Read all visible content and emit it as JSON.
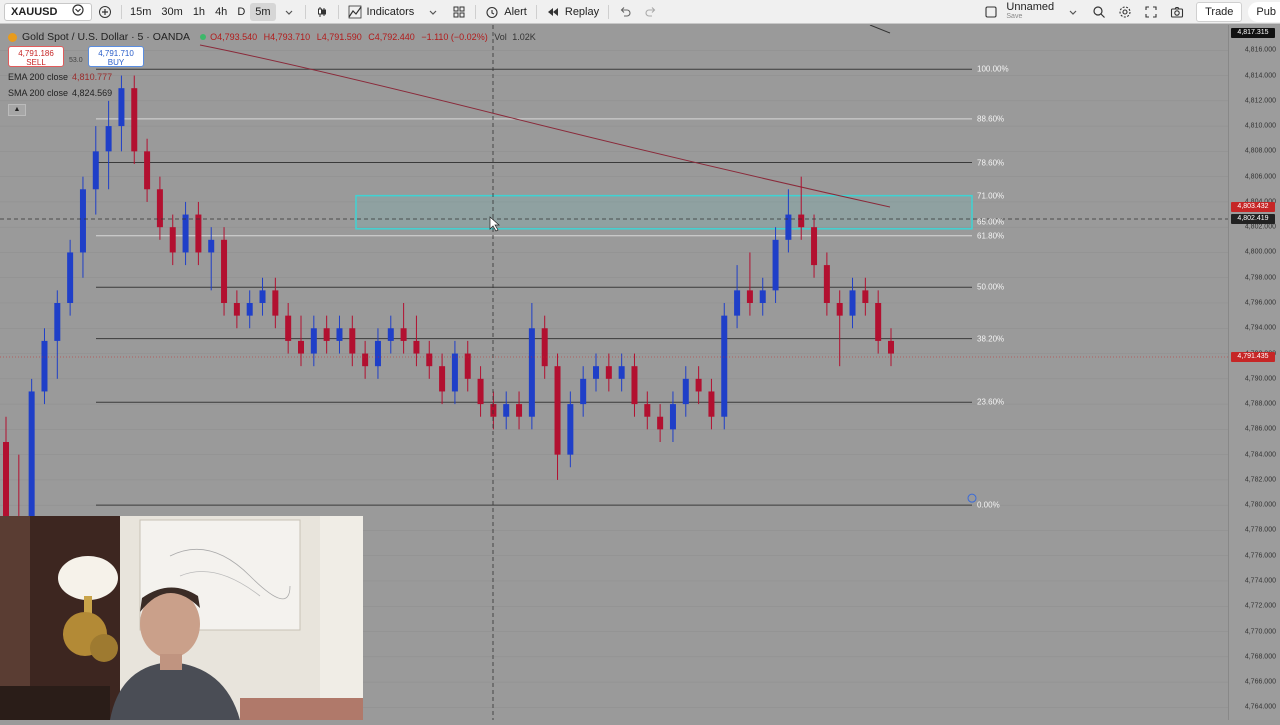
{
  "toolbar": {
    "symbol": "XAUUSD",
    "timeframes": [
      "15m",
      "30m",
      "1h",
      "4h",
      "D",
      "5m"
    ],
    "active_timeframe": "5m",
    "indicators_label": "Indicators",
    "alert_label": "Alert",
    "replay_label": "Replay",
    "layout_name": "Unnamed",
    "layout_status": "Save",
    "trade_label": "Trade",
    "publish_label": "Pub"
  },
  "legend": {
    "title": "Gold Spot / U.S. Dollar · 5 · OANDA",
    "open": "O4,793.540",
    "high": "H4,793.710",
    "low": "L4,791.590",
    "close": "C4,792.440",
    "change": "−1.110 (−0.02%)",
    "volume_label": "Vol",
    "volume": "1.02K",
    "sell_price": "4,791.186",
    "sell_label": "SELL",
    "spread": "53.0",
    "buy_price": "4,791.710",
    "buy_label": "BUY",
    "ema_label": "EMA 200 close",
    "ema_value": "4,810.777",
    "sma_label": "SMA 200 close",
    "sma_value": "4,824.569"
  },
  "price_scale": {
    "ticks": [
      "4,816.000",
      "4,814.000",
      "4,812.000",
      "4,810.000",
      "4,808.000",
      "4,806.000",
      "4,804.000",
      "4,802.000",
      "4,800.000",
      "4,798.000",
      "4,796.000",
      "4,794.000",
      "4,792.000",
      "4,790.000",
      "4,788.000",
      "4,786.000",
      "4,784.000",
      "4,782.000",
      "4,780.000",
      "4,778.000",
      "4,776.000",
      "4,774.000",
      "4,772.000",
      "4,770.000",
      "4,768.000",
      "4,766.000",
      "4,764.000"
    ],
    "top_label": "4,817.315",
    "badge_high": "4,803.432",
    "badge_cursor": "4,802.419",
    "badge_last": "4,791.435",
    "badge_color": "#c62626"
  },
  "fibonacci": {
    "levels": [
      "100.00%",
      "88.60%",
      "78.60%",
      "71.00%",
      "65.00%",
      "61.80%",
      "50.00%",
      "38.20%",
      "23.60%",
      "0.00%"
    ],
    "zone_color": "#3fd3d3"
  },
  "chart_data": {
    "type": "candlestick",
    "up_color": "#1f3fc8",
    "down_color": "#b21030",
    "candles": [
      {
        "o": 4785.0,
        "h": 4787.0,
        "l": 4778.0,
        "c": 4779.0
      },
      {
        "o": 4779.0,
        "h": 4784.0,
        "l": 4776.0,
        "c": 4777.0
      },
      {
        "o": 4777.0,
        "h": 4790.0,
        "l": 4776.0,
        "c": 4789.0
      },
      {
        "o": 4789.0,
        "h": 4794.0,
        "l": 4788.0,
        "c": 4793.0
      },
      {
        "o": 4793.0,
        "h": 4797.0,
        "l": 4790.0,
        "c": 4796.0
      },
      {
        "o": 4796.0,
        "h": 4801.0,
        "l": 4795.0,
        "c": 4800.0
      },
      {
        "o": 4800.0,
        "h": 4806.0,
        "l": 4798.0,
        "c": 4805.0
      },
      {
        "o": 4805.0,
        "h": 4810.0,
        "l": 4803.0,
        "c": 4808.0
      },
      {
        "o": 4808.0,
        "h": 4812.0,
        "l": 4805.0,
        "c": 4810.0
      },
      {
        "o": 4810.0,
        "h": 4814.0,
        "l": 4808.0,
        "c": 4813.0
      },
      {
        "o": 4813.0,
        "h": 4814.0,
        "l": 4807.0,
        "c": 4808.0
      },
      {
        "o": 4808.0,
        "h": 4809.0,
        "l": 4804.0,
        "c": 4805.0
      },
      {
        "o": 4805.0,
        "h": 4806.0,
        "l": 4801.0,
        "c": 4802.0
      },
      {
        "o": 4802.0,
        "h": 4803.0,
        "l": 4799.0,
        "c": 4800.0
      },
      {
        "o": 4800.0,
        "h": 4804.0,
        "l": 4799.0,
        "c": 4803.0
      },
      {
        "o": 4803.0,
        "h": 4804.0,
        "l": 4799.0,
        "c": 4800.0
      },
      {
        "o": 4800.0,
        "h": 4802.0,
        "l": 4797.0,
        "c": 4801.0
      },
      {
        "o": 4801.0,
        "h": 4802.0,
        "l": 4795.0,
        "c": 4796.0
      },
      {
        "o": 4796.0,
        "h": 4797.0,
        "l": 4794.0,
        "c": 4795.0
      },
      {
        "o": 4795.0,
        "h": 4797.0,
        "l": 4794.0,
        "c": 4796.0
      },
      {
        "o": 4796.0,
        "h": 4798.0,
        "l": 4795.0,
        "c": 4797.0
      },
      {
        "o": 4797.0,
        "h": 4798.0,
        "l": 4794.0,
        "c": 4795.0
      },
      {
        "o": 4795.0,
        "h": 4796.0,
        "l": 4792.0,
        "c": 4793.0
      },
      {
        "o": 4793.0,
        "h": 4795.0,
        "l": 4791.0,
        "c": 4792.0
      },
      {
        "o": 4792.0,
        "h": 4795.0,
        "l": 4791.0,
        "c": 4794.0
      },
      {
        "o": 4794.0,
        "h": 4795.0,
        "l": 4792.0,
        "c": 4793.0
      },
      {
        "o": 4793.0,
        "h": 4795.0,
        "l": 4792.0,
        "c": 4794.0
      },
      {
        "o": 4794.0,
        "h": 4795.0,
        "l": 4791.0,
        "c": 4792.0
      },
      {
        "o": 4792.0,
        "h": 4793.0,
        "l": 4790.0,
        "c": 4791.0
      },
      {
        "o": 4791.0,
        "h": 4794.0,
        "l": 4790.0,
        "c": 4793.0
      },
      {
        "o": 4793.0,
        "h": 4795.0,
        "l": 4792.0,
        "c": 4794.0
      },
      {
        "o": 4794.0,
        "h": 4796.0,
        "l": 4792.0,
        "c": 4793.0
      },
      {
        "o": 4793.0,
        "h": 4795.0,
        "l": 4791.0,
        "c": 4792.0
      },
      {
        "o": 4792.0,
        "h": 4793.0,
        "l": 4790.0,
        "c": 4791.0
      },
      {
        "o": 4791.0,
        "h": 4792.0,
        "l": 4788.0,
        "c": 4789.0
      },
      {
        "o": 4789.0,
        "h": 4793.0,
        "l": 4788.0,
        "c": 4792.0
      },
      {
        "o": 4792.0,
        "h": 4793.0,
        "l": 4789.0,
        "c": 4790.0
      },
      {
        "o": 4790.0,
        "h": 4791.0,
        "l": 4787.0,
        "c": 4788.0
      },
      {
        "o": 4788.0,
        "h": 4789.0,
        "l": 4786.0,
        "c": 4787.0
      },
      {
        "o": 4787.0,
        "h": 4789.0,
        "l": 4786.0,
        "c": 4788.0
      },
      {
        "o": 4788.0,
        "h": 4789.0,
        "l": 4786.0,
        "c": 4787.0
      },
      {
        "o": 4787.0,
        "h": 4796.0,
        "l": 4786.0,
        "c": 4794.0
      },
      {
        "o": 4794.0,
        "h": 4795.0,
        "l": 4790.0,
        "c": 4791.0
      },
      {
        "o": 4791.0,
        "h": 4792.0,
        "l": 4782.0,
        "c": 4784.0
      },
      {
        "o": 4784.0,
        "h": 4789.0,
        "l": 4783.0,
        "c": 4788.0
      },
      {
        "o": 4788.0,
        "h": 4791.0,
        "l": 4787.0,
        "c": 4790.0
      },
      {
        "o": 4790.0,
        "h": 4792.0,
        "l": 4789.0,
        "c": 4791.0
      },
      {
        "o": 4791.0,
        "h": 4792.0,
        "l": 4789.0,
        "c": 4790.0
      },
      {
        "o": 4790.0,
        "h": 4792.0,
        "l": 4789.0,
        "c": 4791.0
      },
      {
        "o": 4791.0,
        "h": 4792.0,
        "l": 4787.0,
        "c": 4788.0
      },
      {
        "o": 4788.0,
        "h": 4789.0,
        "l": 4786.0,
        "c": 4787.0
      },
      {
        "o": 4787.0,
        "h": 4788.0,
        "l": 4785.0,
        "c": 4786.0
      },
      {
        "o": 4786.0,
        "h": 4789.0,
        "l": 4785.0,
        "c": 4788.0
      },
      {
        "o": 4788.0,
        "h": 4791.0,
        "l": 4787.0,
        "c": 4790.0
      },
      {
        "o": 4790.0,
        "h": 4791.0,
        "l": 4788.0,
        "c": 4789.0
      },
      {
        "o": 4789.0,
        "h": 4790.0,
        "l": 4786.0,
        "c": 4787.0
      },
      {
        "o": 4787.0,
        "h": 4796.0,
        "l": 4786.0,
        "c": 4795.0
      },
      {
        "o": 4795.0,
        "h": 4799.0,
        "l": 4794.0,
        "c": 4797.0
      },
      {
        "o": 4797.0,
        "h": 4800.0,
        "l": 4795.0,
        "c": 4796.0
      },
      {
        "o": 4796.0,
        "h": 4798.0,
        "l": 4795.0,
        "c": 4797.0
      },
      {
        "o": 4797.0,
        "h": 4802.0,
        "l": 4796.0,
        "c": 4801.0
      },
      {
        "o": 4801.0,
        "h": 4805.0,
        "l": 4800.0,
        "c": 4803.0
      },
      {
        "o": 4803.0,
        "h": 4806.0,
        "l": 4801.0,
        "c": 4802.0
      },
      {
        "o": 4802.0,
        "h": 4803.0,
        "l": 4798.0,
        "c": 4799.0
      },
      {
        "o": 4799.0,
        "h": 4800.0,
        "l": 4795.0,
        "c": 4796.0
      },
      {
        "o": 4796.0,
        "h": 4797.0,
        "l": 4791.0,
        "c": 4795.0
      },
      {
        "o": 4795.0,
        "h": 4798.0,
        "l": 4794.0,
        "c": 4797.0
      },
      {
        "o": 4797.0,
        "h": 4798.0,
        "l": 4795.0,
        "c": 4796.0
      },
      {
        "o": 4796.0,
        "h": 4797.0,
        "l": 4792.0,
        "c": 4793.0
      },
      {
        "o": 4793.0,
        "h": 4794.0,
        "l": 4791.0,
        "c": 4792.0
      }
    ],
    "price_min": 4763.0,
    "price_max": 4818.0
  }
}
